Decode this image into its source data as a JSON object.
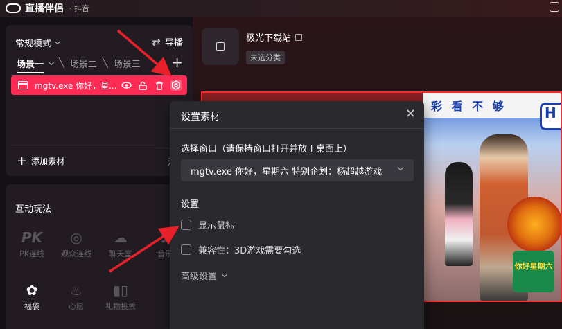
{
  "app": {
    "name": "直播伴侣",
    "platform": "· 抖音"
  },
  "scene_panel": {
    "mode_label": "常规模式",
    "guide_label": "导播",
    "scenes": [
      "场景一",
      "场景二",
      "场景三"
    ],
    "source": {
      "name": "mgtv.exe 你好，星..."
    },
    "add_label": "添加素材",
    "clear_label": "清"
  },
  "interactive_panel": {
    "title": "互动玩法",
    "tools_row1": [
      {
        "icon": "PK",
        "label": "PK连线"
      },
      {
        "icon": "◎",
        "label": "观众连线"
      },
      {
        "icon": "☁",
        "label": "聊天室"
      },
      {
        "icon": "♪",
        "label": "音乐"
      }
    ],
    "tools_row2": [
      {
        "icon": "✿",
        "label": "福袋"
      },
      {
        "icon": "♨",
        "label": "心愿"
      },
      {
        "icon": "▮▯",
        "label": "礼物投票"
      }
    ]
  },
  "material": {
    "title": "极光下载站",
    "tag": "未选分类"
  },
  "dialog": {
    "title": "设置素材",
    "close": "✕",
    "window_label": "选择窗口（请保持窗口打开并放于桌面上）",
    "window_value": "mgtv.exe 你好，星期六 特别企划：杨超越游戏",
    "settings_label": "设置",
    "option_cursor": "显示鼠标",
    "option_compat": "兼容性：3D游戏需要勾选",
    "advanced_label": "高级设置"
  },
  "preview": {
    "banner_text": "彩 看 不 够",
    "h_text": "H",
    "logo_text": "你好星期六"
  },
  "colors": {
    "accent": "#fe2c55",
    "arrow": "#e8202a"
  }
}
